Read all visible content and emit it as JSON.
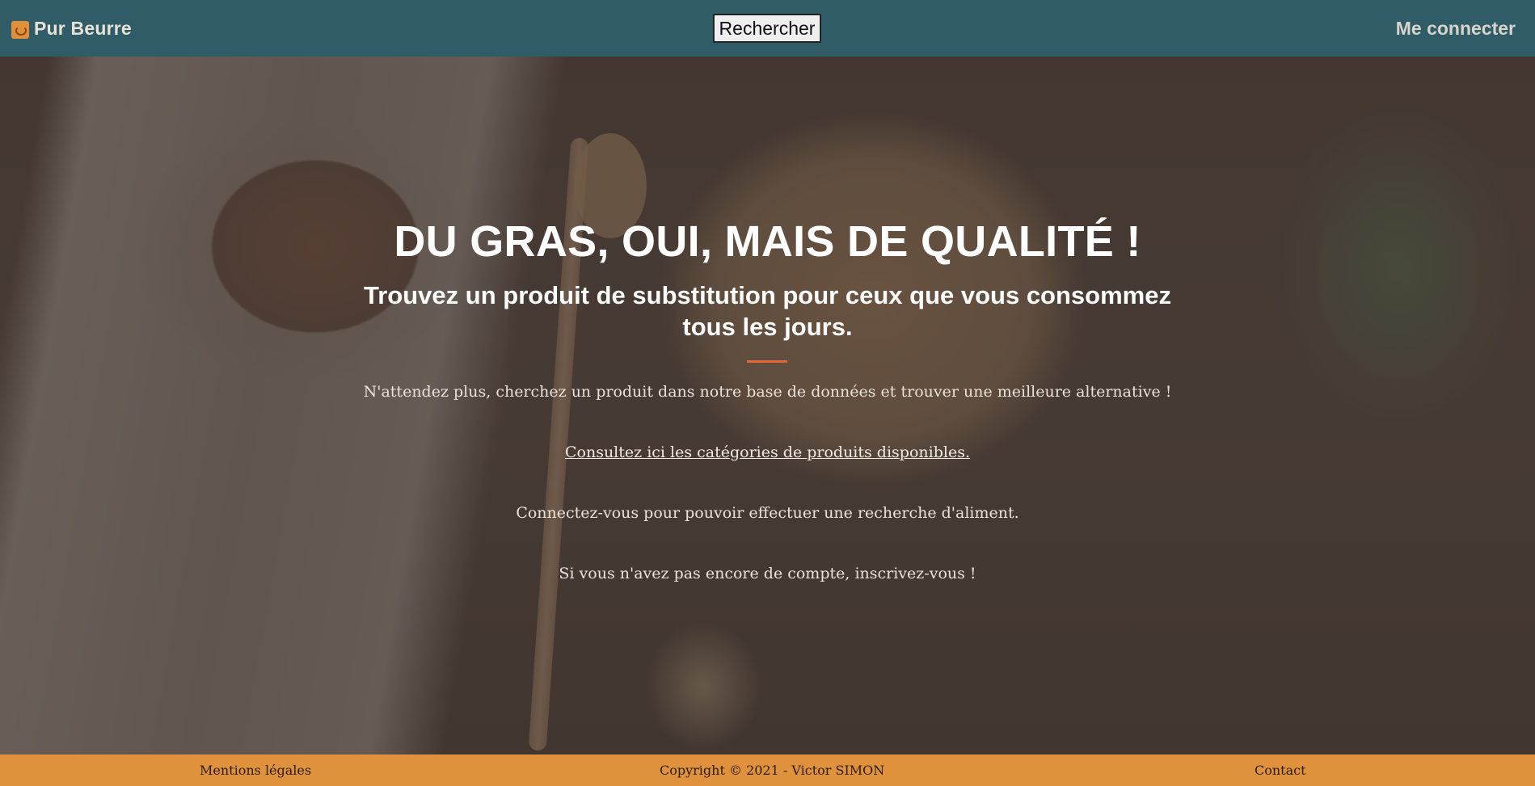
{
  "navbar": {
    "brand_name": "Pur Beurre",
    "brand_logo_icon": "carrot-logo-icon",
    "search_button": "Rechercher",
    "login_link": "Me connecter"
  },
  "hero": {
    "title": "DU GRAS, OUI, MAIS DE QUALITÉ !",
    "subtitle": "Trouvez un produit de substitution pour ceux que vous consommez tous les jours.",
    "text_search": "N'attendez plus, cherchez un produit dans notre base de données et trouver une meilleure alternative !",
    "categories_link": "Consultez ici les catégories de produits disponibles.",
    "text_login": "Connectez-vous pour pouvoir effectuer une recherche d'aliment.",
    "text_signup": "Si vous n'avez pas encore de compte, inscrivez-vous !"
  },
  "footer": {
    "legal": "Mentions légales",
    "copyright": "Copyright © 2021 - Victor SIMON",
    "contact": "Contact"
  },
  "colors": {
    "navbar": "#2f5c66",
    "footer": "#e0913c",
    "divider": "#e2673a"
  }
}
